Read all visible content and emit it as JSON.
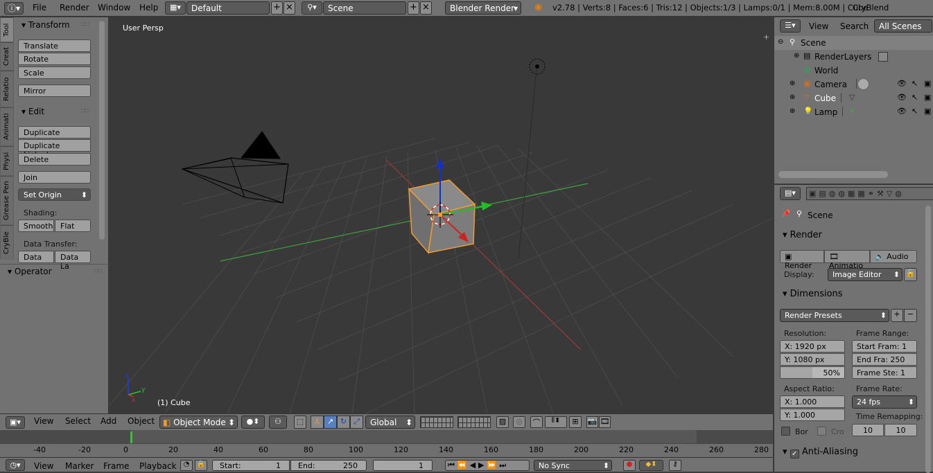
{
  "topbar": {
    "info_icon": "info-icon",
    "menus": [
      "File",
      "Render",
      "Window",
      "Help"
    ],
    "layout": "Default",
    "scene": "Scene",
    "engine": "Blender Render",
    "stats": "v2.78 | Verts:8 | Faces:6 | Tris:12 | Objects:1/3 | Lamps:0/1 | Mem:8.00M | Cube",
    "cryblend": "CryBlend"
  },
  "tool_tabs": [
    "Tool",
    "Creat",
    "Relatio",
    "Animati",
    "Physi",
    "Grease Pen",
    "CryBle"
  ],
  "tools": {
    "transform_header": "Transform",
    "translate": "Translate",
    "rotate": "Rotate",
    "scale": "Scale",
    "mirror": "Mirror",
    "edit_header": "Edit",
    "duplicate": "Duplicate",
    "duplicate_linked": "Duplicate Linked",
    "delete": "Delete",
    "join": "Join",
    "set_origin": "Set Origin",
    "shading_label": "Shading:",
    "smooth": "Smooth",
    "flat": "Flat",
    "data_transfer_label": "Data Transfer:",
    "data": "Data",
    "data_la": "Data La",
    "operator_header": "Operator"
  },
  "viewport": {
    "view_label": "User Persp",
    "object_label": "(1) Cube"
  },
  "view3d_header": {
    "view": "View",
    "select": "Select",
    "add": "Add",
    "object": "Object",
    "mode": "Object Mode",
    "orientation": "Global"
  },
  "timeline": {
    "ticks": [
      "-40",
      "-20",
      "0",
      "20",
      "40",
      "60",
      "80",
      "100",
      "120",
      "140",
      "160",
      "180",
      "200",
      "220",
      "240",
      "260",
      "280"
    ]
  },
  "timeline_header": {
    "view": "View",
    "marker": "Marker",
    "frame": "Frame",
    "playback": "Playback",
    "start_label": "Start:",
    "start_value": "1",
    "end_label": "End:",
    "end_value": "250",
    "current_frame": "1",
    "sync": "No Sync"
  },
  "outliner": {
    "view": "View",
    "search": "Search",
    "scenes": "All Scenes",
    "items": [
      "Scene",
      "RenderLayers",
      "World",
      "Camera",
      "Cube",
      "Lamp"
    ]
  },
  "properties": {
    "context": "Scene",
    "render_header": "Render",
    "render_btn": "Render",
    "animation_btn": "Animatio",
    "audio_btn": "Audio",
    "display_label": "Display:",
    "display_value": "Image Editor",
    "dimensions_header": "Dimensions",
    "render_presets": "Render Presets",
    "resolution_label": "Resolution:",
    "res_x": "X:   1920 px",
    "res_y": "Y:   1080 px",
    "res_pct": "50%",
    "frame_range_label": "Frame Range:",
    "start_frame": "Start Fram: 1",
    "end_frame": "End Fra: 250",
    "frame_step": "Frame Ste: 1",
    "aspect_label": "Aspect Ratio:",
    "aspect_x": "X:     1.000",
    "aspect_y": "Y:     1.000",
    "frame_rate_label": "Frame Rate:",
    "frame_rate": "24 fps",
    "time_remap_label": "Time Remapping:",
    "border": "Bor",
    "crop": "Cro",
    "remap_old": "10",
    "remap_new": "10",
    "antialiasing_header": "Anti-Aliasing"
  },
  "colors": {
    "panel": "#727272",
    "viewport": "#393939",
    "selected": "#f29b2e",
    "x_axis": "#c04040",
    "y_axis": "#40a040"
  }
}
